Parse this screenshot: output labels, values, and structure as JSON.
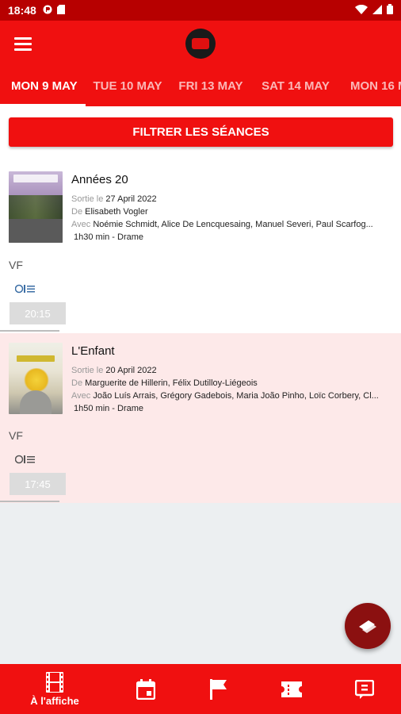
{
  "status_bar": {
    "time": "18:48"
  },
  "tabs": [
    {
      "label": "MON 9 MAY",
      "active": true
    },
    {
      "label": "TUE 10 MAY",
      "active": false
    },
    {
      "label": "FRI 13 MAY",
      "active": false
    },
    {
      "label": "SAT 14 MAY",
      "active": false
    },
    {
      "label": "MON 16 M",
      "active": false
    }
  ],
  "filter_button": "FILTRER LES SÉANCES",
  "labels": {
    "release": "Sortie le",
    "by": "De",
    "with": "Avec"
  },
  "movies": [
    {
      "title": "Années 20",
      "release_date": "27 April 2022",
      "director": "Elisabeth Vogler",
      "cast": "Noémie Schmidt, Alice De Lencquesaing, Manuel Severi, Paul Scarfog...",
      "duration_genre": "1h30 min - Drame",
      "language": "VF",
      "showtime": "20:15"
    },
    {
      "title": "L'Enfant",
      "release_date": "20 April 2022",
      "director": "Marguerite de Hillerin, Félix Dutilloy-Liégeois",
      "cast": "João Luís Arrais, Grégory Gadebois, Maria João Pinho, Loïc Corbery, Cl...",
      "duration_genre": "1h50 min - Drame",
      "language": "VF",
      "showtime": "17:45"
    }
  ],
  "bottom_nav": {
    "active_label": "À l'affiche"
  },
  "colors": {
    "primary": "#f01010",
    "status_bar": "#b70000",
    "fab": "#8b1010",
    "highlight_row": "#fde9e9"
  }
}
